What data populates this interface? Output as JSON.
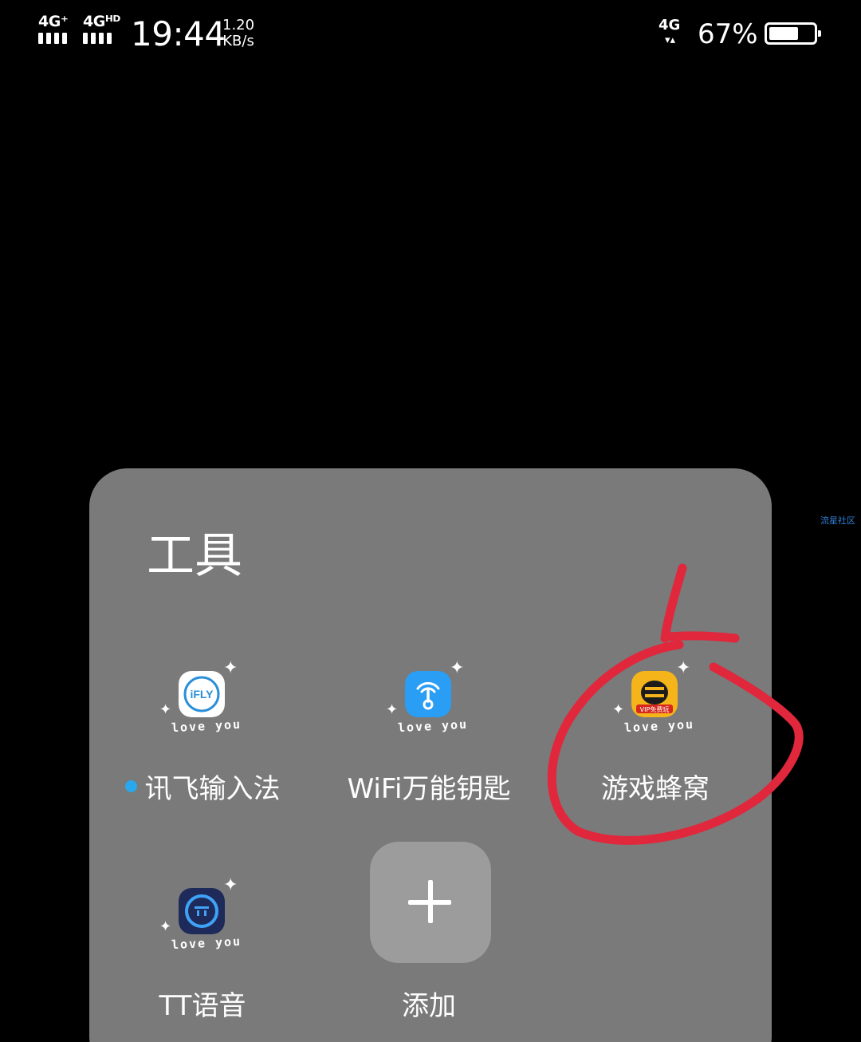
{
  "status_bar": {
    "sim1_network": "4G⁺",
    "sim2_network": "4Gᴴᴰ",
    "time": "19:44",
    "speed_value": "1.20",
    "speed_unit": "KB/s",
    "right_network": "4G",
    "battery_percent": "67%",
    "battery_level": 0.67
  },
  "folder": {
    "title": "工具",
    "apps": [
      {
        "label": "讯飞输入法",
        "icon": "ifly-icon",
        "overlay": "love you",
        "new": true
      },
      {
        "label": "WiFi万能钥匙",
        "icon": "wifi-key-icon",
        "overlay": "love you",
        "new": false
      },
      {
        "label": "游戏蜂窝",
        "icon": "game-hive-icon",
        "overlay": "love you",
        "new": false
      },
      {
        "label": "TT语音",
        "icon": "tt-voice-icon",
        "overlay": "love you",
        "new": false
      }
    ],
    "add_label": "添加"
  },
  "icon_texts": {
    "ifly": "iFLY",
    "game_hive_badge": "VIP免费玩"
  },
  "watermark": "流星社区",
  "colors": {
    "background": "#000000",
    "folder_panel": "#7a7a7a",
    "add_button": "#9c9c9c",
    "new_dot": "#29a8f0",
    "annotation_red": "#e0273c",
    "watermark": "#2f7fd6"
  }
}
